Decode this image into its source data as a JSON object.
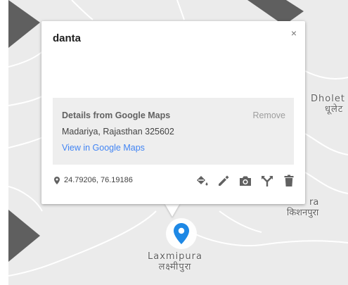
{
  "popup": {
    "title": "danta",
    "close_symbol": "×",
    "details": {
      "heading": "Details from Google Maps",
      "remove_label": "Remove",
      "address": "Madariya, Rajasthan 325602",
      "link_label": "View in Google Maps"
    },
    "coordinates": "24.79206, 76.19186",
    "toolbar_icons": [
      "style-icon",
      "edit-icon",
      "camera-icon",
      "directions-icon",
      "delete-icon"
    ]
  },
  "map": {
    "labels": {
      "dholet_latin": "Dholet",
      "dholet_devanagari": "धूलेट",
      "kishanpura_latin": "ra",
      "kishanpura_devanagari": "किशनपुरा",
      "laxmipura_latin": "Laxmipura",
      "laxmipura_devanagari": "लक्ष्मीपुरा"
    },
    "colors": {
      "background": "#ebebeb",
      "polygon": "#5f5f5f",
      "marker": "#1e88e5"
    }
  }
}
